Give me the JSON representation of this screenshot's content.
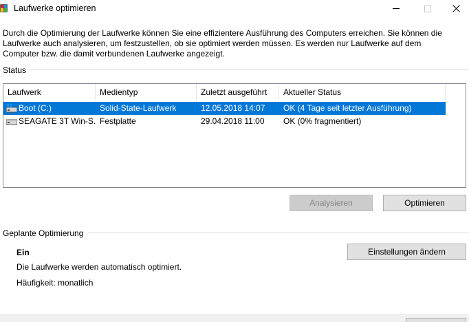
{
  "window": {
    "title": "Laufwerke optimieren",
    "icons": {
      "app": "defrag-app-icon",
      "minimize": "minimize-icon",
      "maximize": "maximize-icon",
      "close": "close-icon"
    }
  },
  "description": "Durch die Optimierung der Laufwerke können Sie eine effizientere Ausführung des Computers erreichen. Sie können die Laufwerke auch analysieren, um festzustellen, ob sie optimiert werden müssen. Es werden nur Laufwerke auf dem Computer bzw. die damit verbundenen Laufwerke angezeigt.",
  "status": {
    "label": "Status",
    "columns": [
      "Laufwerk",
      "Medientyp",
      "Zuletzt ausgeführt",
      "Aktueller Status"
    ],
    "drives": [
      {
        "name": "Boot (C:)",
        "media": "Solid-State-Laufwerk",
        "last_run": "12.05.2018 14:07",
        "status": "OK (4 Tage seit letzter Ausführung)",
        "icon": "windows-drive-icon",
        "selected": true
      },
      {
        "name": "SEAGATE 3T Win-S...",
        "media": "Festplatte",
        "last_run": "29.04.2018 11:00",
        "status": "OK (0% fragmentiert)",
        "icon": "hard-drive-icon",
        "selected": false
      }
    ]
  },
  "actions": {
    "analyze": "Analysieren",
    "optimize": "Optimieren"
  },
  "scheduled": {
    "label": "Geplante Optimierung",
    "state": "Ein",
    "info": "Die Laufwerke werden automatisch optimiert.",
    "frequency": "Häufigkeit: monatlich",
    "change_settings": "Einstellungen ändern"
  },
  "colors": {
    "selection": "#0078d7",
    "disabled_button": "#cccccc",
    "button": "#e1e1e1"
  }
}
